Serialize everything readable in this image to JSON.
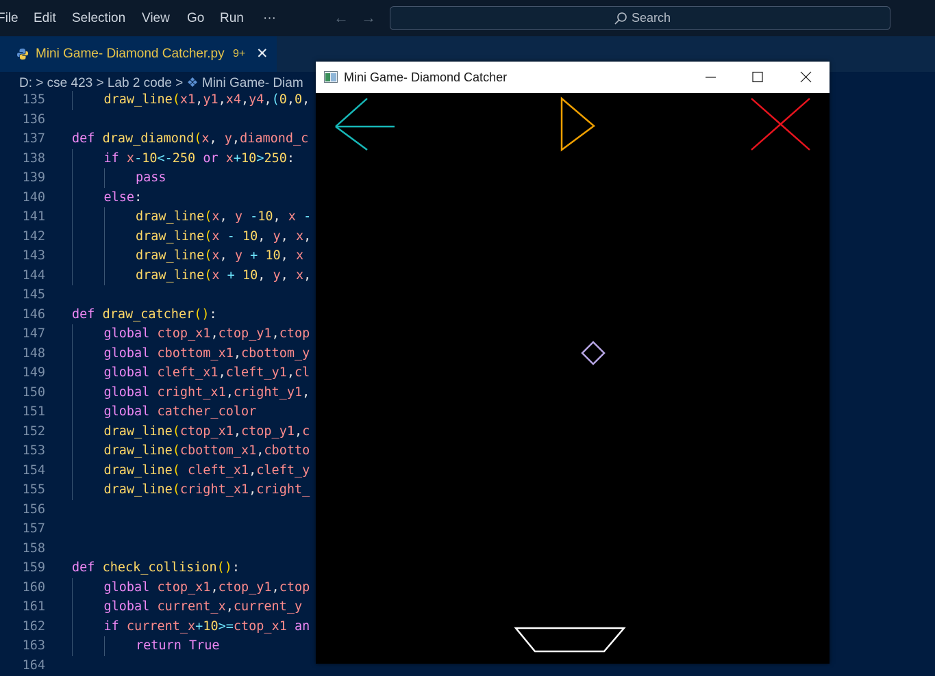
{
  "menu": [
    "File",
    "Edit",
    "Selection",
    "View",
    "Go",
    "Run",
    "···"
  ],
  "search": {
    "placeholder": "Search"
  },
  "tab": {
    "label": "Mini Game- Diamond Catcher.py",
    "badge": "9+",
    "close": "✕"
  },
  "breadcrumb": {
    "drive": "D:",
    "folder1": "cse 423",
    "folder2": "Lab 2 code",
    "file": "Mini Game- Diam"
  },
  "code_lines": [
    {
      "n": "135",
      "indent": 2,
      "t": [
        [
          "f",
          "draw_line"
        ],
        [
          "p",
          "("
        ],
        [
          "v",
          "x1"
        ],
        [
          "pl",
          ","
        ],
        [
          "v",
          "y1"
        ],
        [
          "pl",
          ","
        ],
        [
          "v",
          "x4"
        ],
        [
          "pl",
          ","
        ],
        [
          "v",
          "y4"
        ],
        [
          "pl",
          ","
        ],
        [
          "o",
          "("
        ],
        [
          "n",
          "0"
        ],
        [
          "pl",
          ","
        ],
        [
          "n",
          "0"
        ],
        [
          "pl",
          ","
        ]
      ]
    },
    {
      "n": "136",
      "indent": 0,
      "t": []
    },
    {
      "n": "137",
      "indent": 1,
      "t": [
        [
          "k",
          "def "
        ],
        [
          "f",
          "draw_diamond"
        ],
        [
          "p",
          "("
        ],
        [
          "v",
          "x"
        ],
        [
          "pl",
          ", "
        ],
        [
          "v",
          "y"
        ],
        [
          "pl",
          ","
        ],
        [
          "v",
          "diamond_c"
        ]
      ]
    },
    {
      "n": "138",
      "indent": 2,
      "t": [
        [
          "k",
          "if "
        ],
        [
          "v",
          "x"
        ],
        [
          "o",
          "-"
        ],
        [
          "n",
          "10"
        ],
        [
          "o",
          "<-"
        ],
        [
          "n",
          "250"
        ],
        [
          "k",
          " or "
        ],
        [
          "v",
          "x"
        ],
        [
          "o",
          "+"
        ],
        [
          "n",
          "10"
        ],
        [
          "o",
          ">"
        ],
        [
          "n",
          "250"
        ],
        [
          "pl",
          ":"
        ]
      ]
    },
    {
      "n": "139",
      "indent": 3,
      "t": [
        [
          "k",
          "pass"
        ]
      ]
    },
    {
      "n": "140",
      "indent": 2,
      "t": [
        [
          "k",
          "else"
        ],
        [
          "pl",
          ":"
        ]
      ]
    },
    {
      "n": "141",
      "indent": 3,
      "t": [
        [
          "f",
          "draw_line"
        ],
        [
          "p",
          "("
        ],
        [
          "v",
          "x"
        ],
        [
          "pl",
          ", "
        ],
        [
          "v",
          "y"
        ],
        [
          "o",
          " -"
        ],
        [
          "n",
          "10"
        ],
        [
          "pl",
          ", "
        ],
        [
          "v",
          "x"
        ],
        [
          "o",
          " -"
        ]
      ]
    },
    {
      "n": "142",
      "indent": 3,
      "t": [
        [
          "f",
          "draw_line"
        ],
        [
          "p",
          "("
        ],
        [
          "v",
          "x"
        ],
        [
          "o",
          " - "
        ],
        [
          "n",
          "10"
        ],
        [
          "pl",
          ", "
        ],
        [
          "v",
          "y"
        ],
        [
          "pl",
          ", "
        ],
        [
          "v",
          "x"
        ],
        [
          "pl",
          ","
        ]
      ]
    },
    {
      "n": "143",
      "indent": 3,
      "t": [
        [
          "f",
          "draw_line"
        ],
        [
          "p",
          "("
        ],
        [
          "v",
          "x"
        ],
        [
          "pl",
          ", "
        ],
        [
          "v",
          "y"
        ],
        [
          "o",
          " + "
        ],
        [
          "n",
          "10"
        ],
        [
          "pl",
          ", "
        ],
        [
          "v",
          "x"
        ]
      ]
    },
    {
      "n": "144",
      "indent": 3,
      "t": [
        [
          "f",
          "draw_line"
        ],
        [
          "p",
          "("
        ],
        [
          "v",
          "x"
        ],
        [
          "o",
          " + "
        ],
        [
          "n",
          "10"
        ],
        [
          "pl",
          ", "
        ],
        [
          "v",
          "y"
        ],
        [
          "pl",
          ", "
        ],
        [
          "v",
          "x"
        ],
        [
          "pl",
          ","
        ]
      ]
    },
    {
      "n": "145",
      "indent": 0,
      "t": []
    },
    {
      "n": "146",
      "indent": 1,
      "t": [
        [
          "k",
          "def "
        ],
        [
          "f",
          "draw_catcher"
        ],
        [
          "p",
          "()"
        ],
        [
          "pl",
          ":"
        ]
      ]
    },
    {
      "n": "147",
      "indent": 2,
      "t": [
        [
          "k",
          "global "
        ],
        [
          "v",
          "ctop_x1"
        ],
        [
          "pl",
          ","
        ],
        [
          "v",
          "ctop_y1"
        ],
        [
          "pl",
          ","
        ],
        [
          "v",
          "ctop"
        ]
      ]
    },
    {
      "n": "148",
      "indent": 2,
      "t": [
        [
          "k",
          "global "
        ],
        [
          "v",
          "cbottom_x1"
        ],
        [
          "pl",
          ","
        ],
        [
          "v",
          "cbottom_y"
        ]
      ]
    },
    {
      "n": "149",
      "indent": 2,
      "t": [
        [
          "k",
          "global "
        ],
        [
          "v",
          "cleft_x1"
        ],
        [
          "pl",
          ","
        ],
        [
          "v",
          "cleft_y1"
        ],
        [
          "pl",
          ","
        ],
        [
          "v",
          "cl"
        ]
      ]
    },
    {
      "n": "150",
      "indent": 2,
      "t": [
        [
          "k",
          "global "
        ],
        [
          "v",
          "cright_x1"
        ],
        [
          "pl",
          ","
        ],
        [
          "v",
          "cright_y1"
        ],
        [
          "pl",
          ","
        ]
      ]
    },
    {
      "n": "151",
      "indent": 2,
      "t": [
        [
          "k",
          "global "
        ],
        [
          "v",
          "catcher_color"
        ]
      ]
    },
    {
      "n": "152",
      "indent": 2,
      "t": [
        [
          "f",
          "draw_line"
        ],
        [
          "p",
          "("
        ],
        [
          "v",
          "ctop_x1"
        ],
        [
          "pl",
          ","
        ],
        [
          "v",
          "ctop_y1"
        ],
        [
          "pl",
          ","
        ],
        [
          "v",
          "c"
        ]
      ]
    },
    {
      "n": "153",
      "indent": 2,
      "t": [
        [
          "f",
          "draw_line"
        ],
        [
          "p",
          "("
        ],
        [
          "v",
          "cbottom_x1"
        ],
        [
          "pl",
          ","
        ],
        [
          "v",
          "cbotto"
        ]
      ]
    },
    {
      "n": "154",
      "indent": 2,
      "t": [
        [
          "f",
          "draw_line"
        ],
        [
          "p",
          "("
        ],
        [
          "pl",
          " "
        ],
        [
          "v",
          "cleft_x1"
        ],
        [
          "pl",
          ","
        ],
        [
          "v",
          "cleft_y"
        ]
      ]
    },
    {
      "n": "155",
      "indent": 2,
      "t": [
        [
          "f",
          "draw_line"
        ],
        [
          "p",
          "("
        ],
        [
          "v",
          "cright_x1"
        ],
        [
          "pl",
          ","
        ],
        [
          "v",
          "cright_"
        ]
      ]
    },
    {
      "n": "156",
      "indent": 0,
      "t": []
    },
    {
      "n": "157",
      "indent": 0,
      "t": []
    },
    {
      "n": "158",
      "indent": 0,
      "t": []
    },
    {
      "n": "159",
      "indent": 1,
      "t": [
        [
          "k",
          "def "
        ],
        [
          "f",
          "check_collision"
        ],
        [
          "p",
          "()"
        ],
        [
          "pl",
          ":"
        ]
      ]
    },
    {
      "n": "160",
      "indent": 2,
      "t": [
        [
          "k",
          "global "
        ],
        [
          "v",
          "ctop_x1"
        ],
        [
          "pl",
          ","
        ],
        [
          "v",
          "ctop_y1"
        ],
        [
          "pl",
          ","
        ],
        [
          "v",
          "ctop"
        ]
      ]
    },
    {
      "n": "161",
      "indent": 2,
      "t": [
        [
          "k",
          "global "
        ],
        [
          "v",
          "current_x"
        ],
        [
          "pl",
          ","
        ],
        [
          "v",
          "current_y"
        ]
      ]
    },
    {
      "n": "162",
      "indent": 2,
      "t": [
        [
          "k",
          "if "
        ],
        [
          "v",
          "current_x"
        ],
        [
          "o",
          "+"
        ],
        [
          "n",
          "10"
        ],
        [
          "o",
          ">="
        ],
        [
          "v",
          "ctop_x1"
        ],
        [
          "k",
          " an"
        ]
      ]
    },
    {
      "n": "163",
      "indent": 3,
      "t": [
        [
          "k",
          "return "
        ],
        [
          "k",
          "True"
        ]
      ]
    },
    {
      "n": "164",
      "indent": 0,
      "t": []
    }
  ],
  "game_window": {
    "title": "Mini Game- Diamond Catcher",
    "colors": {
      "back_arrow": "#17b8b8",
      "play": "#f0a000",
      "close": "#e8141e",
      "diamond": "#b8a7e6",
      "catcher": "#ffffff"
    }
  }
}
